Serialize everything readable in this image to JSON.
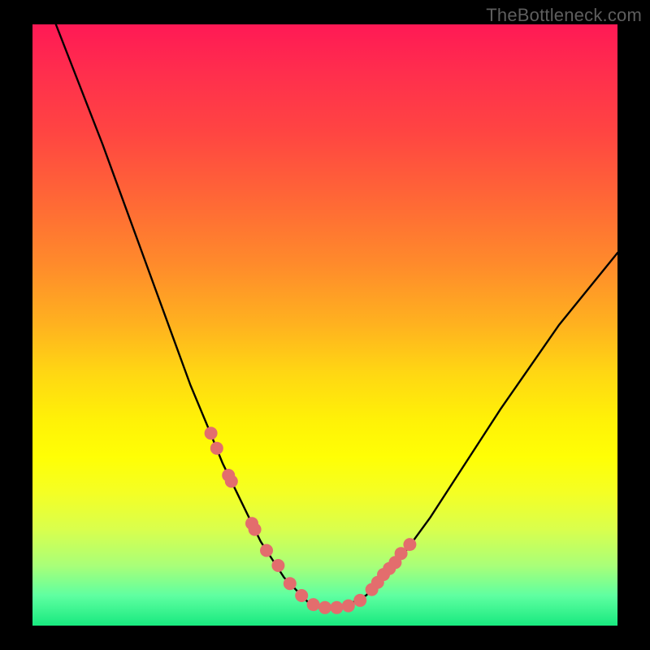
{
  "watermark": "TheBottleneck.com",
  "chart_data": {
    "type": "line",
    "title": "",
    "xlabel": "",
    "ylabel": "",
    "xlim": [
      0,
      100
    ],
    "ylim": [
      0,
      100
    ],
    "series": [
      {
        "name": "curve",
        "x": [
          4,
          8,
          12,
          15,
          18,
          21,
          24,
          27,
          30,
          32.5,
          35,
          37,
          39,
          41,
          43,
          45,
          47,
          49,
          51,
          53,
          55,
          57,
          59,
          62,
          65,
          68,
          72,
          76,
          80,
          85,
          90,
          95,
          100
        ],
        "y": [
          100,
          90,
          80,
          72,
          64,
          56,
          48,
          40,
          33,
          27,
          22,
          18,
          14,
          11,
          8,
          6,
          4,
          3,
          3,
          3,
          4,
          5,
          7,
          10,
          14,
          18,
          24,
          30,
          36,
          43,
          50,
          56,
          62
        ]
      }
    ],
    "markers": {
      "name": "highlight-points",
      "x": [
        30.5,
        31.5,
        33.5,
        34,
        37.5,
        38,
        40,
        42,
        44,
        46,
        48,
        50,
        52,
        54,
        56,
        58,
        59,
        60,
        61,
        62,
        63,
        64.5
      ],
      "y": [
        32,
        29.5,
        25,
        24,
        17,
        16,
        12.5,
        10,
        7,
        5,
        3.5,
        3,
        3,
        3.3,
        4.2,
        6,
        7.2,
        8.5,
        9.5,
        10.5,
        12,
        13.5
      ]
    },
    "note": "x and y in percent of plot area. y=0 at bottom (green), y=100 at top (red)."
  }
}
